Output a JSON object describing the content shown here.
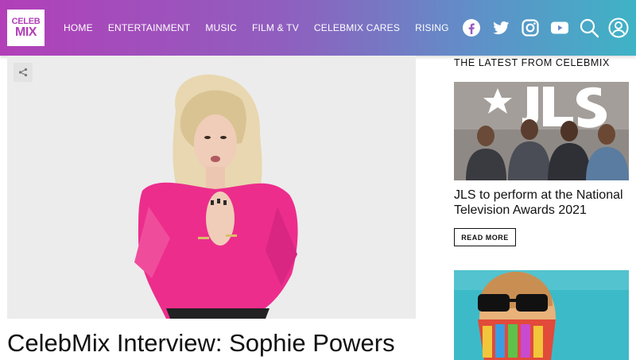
{
  "header": {
    "logo_line1": "CELEB",
    "logo_line2": "MIX",
    "nav": [
      "HOME",
      "ENTERTAINMENT",
      "MUSIC",
      "FILM & TV",
      "CELEBMIX CARES",
      "RISING"
    ],
    "icons": [
      "facebook-icon",
      "twitter-icon",
      "instagram-icon",
      "youtube-icon",
      "search-icon",
      "user-icon"
    ],
    "gradient": [
      "#b23fb8",
      "#5f90c8",
      "#3fb3c6"
    ]
  },
  "main": {
    "headline": "CelebMix Interview: Sophie Powers",
    "share_icon": "share-icon",
    "image_alt": "Blonde woman in pink fluffy top"
  },
  "sidebar": {
    "section_title": "THE LATEST FROM CELEBMIX",
    "card1": {
      "image_text": "JLS",
      "title": "JLS to perform at the National Television Awards 2021",
      "button": "READ MORE"
    },
    "card2": {
      "image_alt": "Elton John with sequin mask"
    }
  }
}
